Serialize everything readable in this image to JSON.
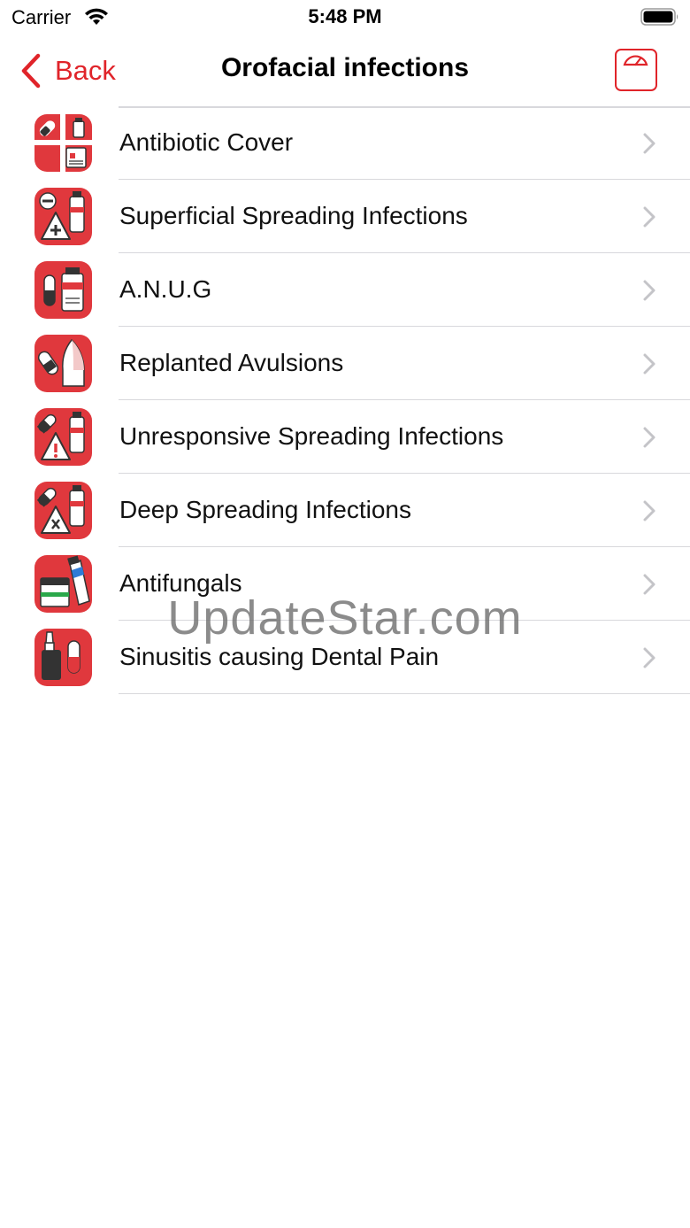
{
  "status_bar": {
    "carrier": "Carrier",
    "time": "5:48 PM"
  },
  "nav": {
    "back_label": "Back",
    "title": "Orofacial infections",
    "right_icon": "scale-icon"
  },
  "colors": {
    "accent": "#e0242a",
    "icon_bg": "#e0383d",
    "divider": "#d8d8dc",
    "chevron": "#c4c4c8"
  },
  "list": {
    "items": [
      {
        "label": "Antibiotic Cover",
        "icon": "pill-bottle-prescription-icon"
      },
      {
        "label": "Superficial Spreading Infections",
        "icon": "pill-bottle-warning-plus-icon"
      },
      {
        "label": "A.N.U.G",
        "icon": "capsule-bottle-icon"
      },
      {
        "label": "Replanted Avulsions",
        "icon": "capsule-tooth-icon"
      },
      {
        "label": "Unresponsive Spreading Infections",
        "icon": "pill-bottle-warning-exclamation-icon"
      },
      {
        "label": "Deep Spreading Infections",
        "icon": "pill-bottle-warning-x-icon"
      },
      {
        "label": "Antifungals",
        "icon": "ointment-tube-jar-icon"
      },
      {
        "label": "Sinusitis causing Dental Pain",
        "icon": "nasal-spray-capsule-icon"
      }
    ]
  },
  "watermark": "UpdateStar.com"
}
